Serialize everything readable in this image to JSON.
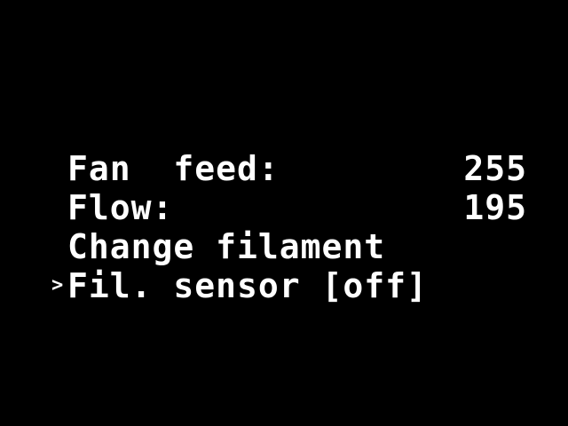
{
  "colors": {
    "background": "#000000",
    "text": "#ffffff"
  },
  "menu": {
    "items": [
      {
        "label": "Fan  feed:",
        "value": "255",
        "selected": false
      },
      {
        "label": "Flow:",
        "value": "195",
        "selected": false
      },
      {
        "label": "Change filament",
        "value": "",
        "selected": false
      },
      {
        "label": "Fil. sensor [off]",
        "value": "",
        "selected": true,
        "cursor": ">"
      }
    ]
  }
}
